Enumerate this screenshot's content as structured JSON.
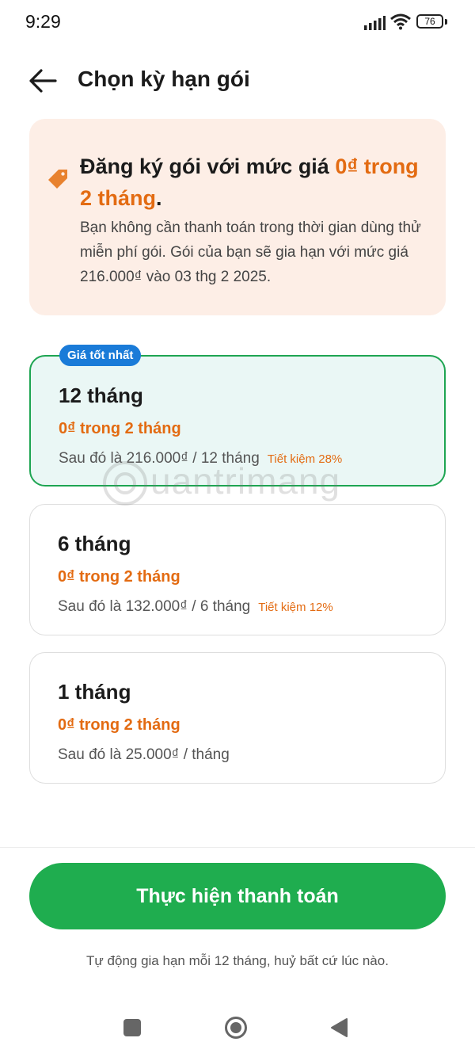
{
  "status_bar": {
    "time": "9:29",
    "battery": "76"
  },
  "header": {
    "title": "Chọn kỳ hạn gói"
  },
  "promo": {
    "title_prefix": "Đăng ký gói với mức giá ",
    "title_accent": "0₫ trong 2 tháng",
    "title_suffix": ".",
    "description": "Bạn không cần thanh toán trong thời gian dùng thử miễn phí gói. Gói của bạn sẽ gia hạn với mức giá 216.000₫ vào 03 thg 2 2025."
  },
  "plans": [
    {
      "badge": "Giá tốt nhất",
      "name": "12 tháng",
      "promo": "0₫ trong 2 tháng",
      "after": "Sau đó là 216.000₫ / 12 tháng",
      "saving": "Tiết kiệm 28%",
      "selected": true
    },
    {
      "name": "6 tháng",
      "promo": "0₫ trong 2 tháng",
      "after": "Sau đó là 132.000₫ / 6 tháng",
      "saving": "Tiết kiệm 12%"
    },
    {
      "name": "1 tháng",
      "promo": "0₫ trong 2 tháng",
      "after": "Sau đó là 25.000₫ / tháng"
    }
  ],
  "watermark": "uantrimang",
  "footer": {
    "pay_label": "Thực hiện thanh toán",
    "auto_renew_note": "Tự động gia hạn mỗi 12 tháng, huỷ bất cứ lúc nào."
  },
  "colors": {
    "accent": "#e36b12",
    "primary": "#1fad4f",
    "badge": "#1a7bd8",
    "selected_bg": "#eaf7f5"
  }
}
